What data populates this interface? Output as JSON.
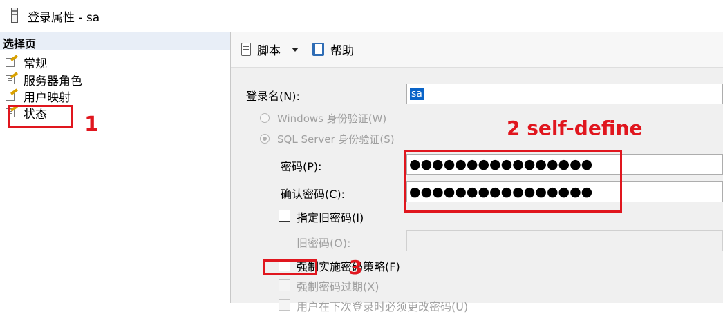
{
  "window": {
    "title": "登录属性 - sa"
  },
  "sidebar": {
    "header": "选择页",
    "items": [
      {
        "label": "常规"
      },
      {
        "label": "服务器角色"
      },
      {
        "label": "用户映射"
      },
      {
        "label": "状态"
      }
    ]
  },
  "toolbar": {
    "script_label": "脚本",
    "help_label": "帮助"
  },
  "form": {
    "login_name_label": "登录名(N):",
    "login_name_value": "sa",
    "windows_auth_label": "Windows 身份验证(W)",
    "sql_auth_label": "SQL Server 身份验证(S)",
    "password_label": "密码(P):",
    "password_value": "●●●●●●●●●●●●●●●●",
    "confirm_label": "确认密码(C):",
    "confirm_value": "●●●●●●●●●●●●●●●●",
    "specify_old_label": "指定旧密码(I)",
    "old_password_label": "旧密码(O):",
    "enforce_policy_label": "强制实施密码策略(F)",
    "enforce_expiration_label": "强制密码过期(X)",
    "must_change_label": "用户在下次登录时必须更改密码(U)"
  },
  "annotations": {
    "one": "1",
    "two": "2 self-define",
    "three": "3",
    "color": "#e0161e"
  }
}
